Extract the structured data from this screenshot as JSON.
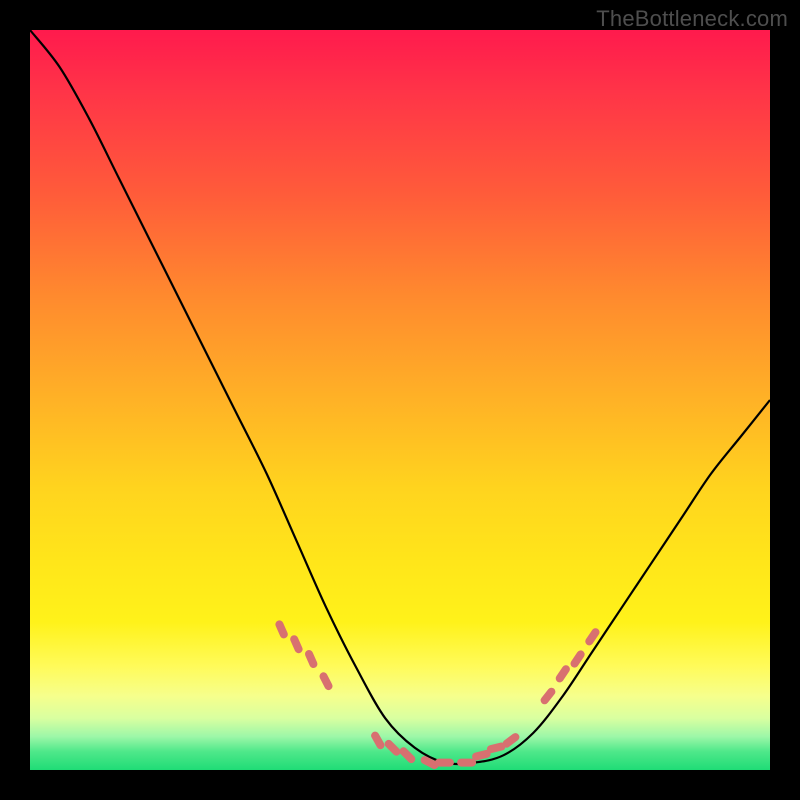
{
  "watermark": "TheBottleneck.com",
  "chart_data": {
    "type": "line",
    "title": "",
    "xlabel": "",
    "ylabel": "",
    "xlim": [
      0,
      1
    ],
    "ylim": [
      0,
      1
    ],
    "grid": false,
    "series": [
      {
        "name": "bottleneck-curve",
        "x": [
          0.0,
          0.04,
          0.08,
          0.12,
          0.16,
          0.2,
          0.24,
          0.28,
          0.32,
          0.36,
          0.4,
          0.44,
          0.48,
          0.52,
          0.56,
          0.6,
          0.64,
          0.68,
          0.72,
          0.76,
          0.8,
          0.84,
          0.88,
          0.92,
          0.96,
          1.0
        ],
        "y": [
          1.0,
          0.95,
          0.88,
          0.8,
          0.72,
          0.64,
          0.56,
          0.48,
          0.4,
          0.31,
          0.22,
          0.14,
          0.07,
          0.03,
          0.01,
          0.01,
          0.02,
          0.05,
          0.1,
          0.16,
          0.22,
          0.28,
          0.34,
          0.4,
          0.45,
          0.5
        ]
      },
      {
        "name": "highlight-marks",
        "x": [
          0.34,
          0.36,
          0.38,
          0.4,
          0.47,
          0.49,
          0.51,
          0.54,
          0.56,
          0.59,
          0.61,
          0.63,
          0.65,
          0.7,
          0.72,
          0.74,
          0.76
        ],
        "y": [
          0.19,
          0.17,
          0.15,
          0.12,
          0.04,
          0.03,
          0.02,
          0.01,
          0.01,
          0.01,
          0.02,
          0.03,
          0.04,
          0.1,
          0.13,
          0.15,
          0.18
        ]
      }
    ],
    "colors": {
      "curve": "#000000",
      "marks": "#d87070"
    }
  }
}
